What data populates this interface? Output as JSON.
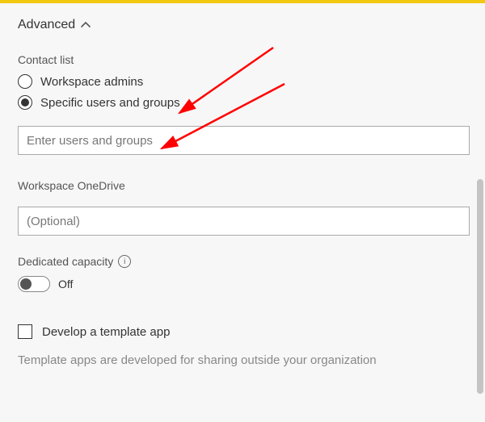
{
  "section": {
    "title": "Advanced"
  },
  "contact_list": {
    "label": "Contact list",
    "options": {
      "workspace_admins": "Workspace admins",
      "specific_users": "Specific users and groups"
    },
    "selected": "specific_users",
    "input_placeholder": "Enter users and groups"
  },
  "onedrive": {
    "label": "Workspace OneDrive",
    "placeholder": "(Optional)"
  },
  "dedicated_capacity": {
    "label": "Dedicated capacity",
    "value": false,
    "value_label": "Off"
  },
  "template_app": {
    "checkbox_label": "Develop a template app",
    "checked": false,
    "help_text": "Template apps are developed for sharing outside your organization"
  },
  "colors": {
    "accent": "#f2c811",
    "annotation": "#ff0000"
  }
}
